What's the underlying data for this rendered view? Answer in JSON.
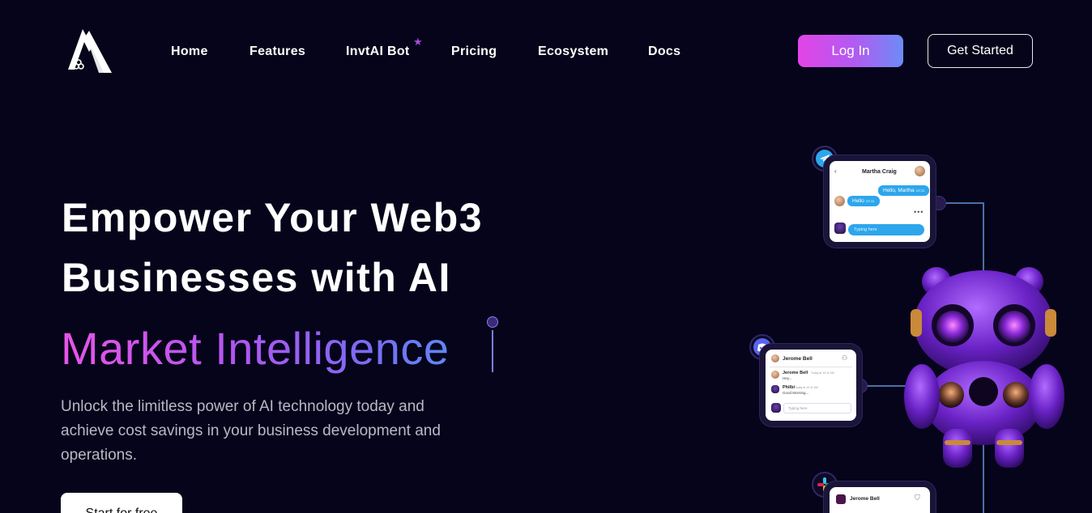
{
  "nav": {
    "items": [
      "Home",
      "Features",
      "InvtAI Bot",
      "Pricing",
      "Ecosystem",
      "Docs"
    ],
    "login_label": "Log In",
    "get_started_label": "Get Started"
  },
  "hero": {
    "title_line1": "Empower Your Web3",
    "title_line2": "Businesses with AI",
    "accent": "Market Intelligence",
    "subtitle": "Unlock the limitless power of AI technology today and achieve cost savings in your business development and operations.",
    "cta_label": "Start for free"
  },
  "chats": {
    "telegram": {
      "contact": "Martha Craig",
      "msg_out": "Hello, Martha",
      "msg_out_time": "10:11",
      "msg_in": "Hello",
      "msg_in_time": "10:11",
      "typing": "Typing here"
    },
    "discord": {
      "contact": "Jerome Bell",
      "msg1_name": "Jerome Bell",
      "msg1_time": "Today at 10:11 AM",
      "msg1_text": "Hey...",
      "msg2_name": "Philbi",
      "msg2_time": "Today at 10:11 AM",
      "msg2_text": "Good Morning...",
      "typing": "Typing here"
    },
    "slack": {
      "contact": "Jerome Bell"
    }
  },
  "colors": {
    "background": "#06041a",
    "accent_pink": "#e244e6",
    "accent_blue": "#6c8cf6",
    "chat_blue": "#2ea6ec"
  }
}
